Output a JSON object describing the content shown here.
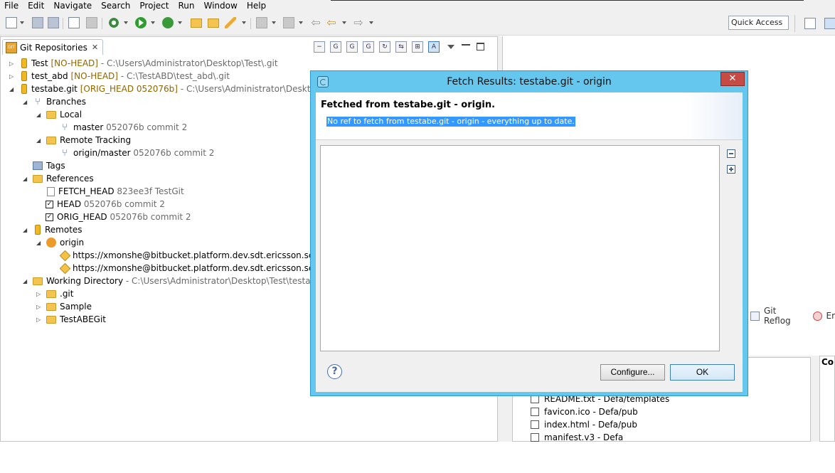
{
  "menubar": [
    "File",
    "Edit",
    "Navigate",
    "Search",
    "Project",
    "Run",
    "Window",
    "Help"
  ],
  "toolbar": {
    "quick_access": "Quick Access"
  },
  "git_view": {
    "tab_label": "Git Repositories",
    "tab_close": "✕",
    "rows": [
      {
        "name": "Test",
        "decoration": "[NO-HEAD]",
        "path": "- C:\\Users\\Administrator\\Desktop\\Test\\.git"
      },
      {
        "name": "test_abd",
        "decoration": "[NO-HEAD]",
        "path": "- C:\\TestABD\\test_abd\\.git"
      },
      {
        "name": "testabe.git",
        "decoration": "[ORIG_HEAD 052076b]",
        "path": "- C:\\Users\\Administrator\\Desktop\\Test\\"
      },
      {
        "name": "Branches"
      },
      {
        "name": "Local"
      },
      {
        "name": "master",
        "meta": "052076b commit 2"
      },
      {
        "name": "Remote Tracking"
      },
      {
        "name": "origin/master",
        "meta": "052076b commit 2"
      },
      {
        "name": "Tags"
      },
      {
        "name": "References"
      },
      {
        "name": "FETCH_HEAD",
        "meta": "823ee3f TestGit"
      },
      {
        "name": "HEAD",
        "meta": "052076b commit 2"
      },
      {
        "name": "ORIG_HEAD",
        "meta": "052076b commit 2"
      },
      {
        "name": "Remotes"
      },
      {
        "name": "origin"
      },
      {
        "name": "https://xmonshe@bitbucket.platform.dev.sdt.ericsson.se/scm/"
      },
      {
        "name": "https://xmonshe@bitbucket.platform.dev.sdt.ericsson.se/scm/"
      },
      {
        "name": "Working Directory",
        "path": "- C:\\Users\\Administrator\\Desktop\\Test\\testabe.git"
      },
      {
        "name": ".git"
      },
      {
        "name": "Sample"
      },
      {
        "name": "TestABEGit"
      }
    ]
  },
  "right_tabs": {
    "reflog": "Git Reflog",
    "error": "Er"
  },
  "bottom_right": {
    "console_label": "Co",
    "files": [
      "README.txt - Defa/templates",
      "favicon.ico - Defa/pub",
      "index.html - Defa/pub",
      "manifest.v3 - Defa"
    ]
  },
  "dialog": {
    "title": "Fetch Results: testabe.git - origin",
    "close": "✕",
    "header_title": "Fetched from testabe.git - origin.",
    "message": "No ref to fetch from testabe.git - origin - everything up to date.",
    "help": "?",
    "configure": "Configure...",
    "ok": "OK"
  },
  "colors": {
    "dialog_frame": "#65c6ee",
    "close_button": "#c74b45",
    "selection": "#3399ff",
    "decoration": "#8f6500"
  }
}
